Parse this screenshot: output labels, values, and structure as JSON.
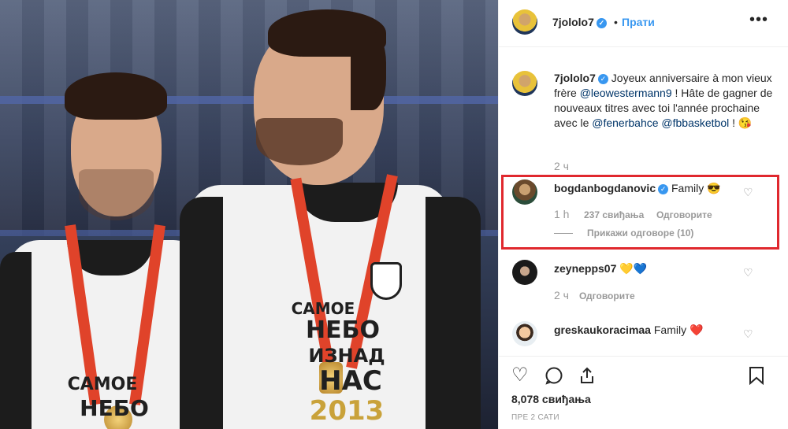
{
  "post": {
    "author": "7jololo7",
    "follow_label": "Прати",
    "more_label": "•••",
    "caption_author": "7jololo7",
    "caption_part1": "Joyeux anniversaire à mon vieux frère ",
    "caption_mention1": "@leowestermann9",
    "caption_part2": " ! Hâte de gagner de nouveaux titres avec toi l'année prochaine avec le ",
    "caption_mention2": "@fenerbahce",
    "caption_part3": " ",
    "caption_mention3": "@fbbasketbol",
    "caption_part4": " ! 😘",
    "caption_time": "2 ч"
  },
  "comments": [
    {
      "user": "bogdanbogdanovic",
      "text": "Family 😎",
      "time": "1 h",
      "likes": "237 свиђања",
      "reply": "Одговорите",
      "view_replies": "Прикажи одговоре (10)"
    },
    {
      "user": "zeynepps07",
      "text": "💛💙",
      "time": "2 ч",
      "reply": "Одговорите"
    },
    {
      "user": "greskaukoracimaa",
      "text": "Family ❤️"
    }
  ],
  "actions": {
    "likes": "8,078 свиђања",
    "ago": "ПРЕ 2 САТИ"
  },
  "photo": {
    "shirt_line1": "САМОЕ",
    "shirt_line2": "НЕБО",
    "shirt_line3": "ИЗНАД",
    "shirt_line4": "НАС",
    "shirt_year": "2013",
    "left_line1": "САМОЕ",
    "left_line2": "НЕБО"
  },
  "colors": {
    "accent_blue": "#3897f0",
    "highlight_red": "#e0282e",
    "ribbon": "#e0432a"
  },
  "icons": {
    "like": "heart-icon",
    "comment": "comment-icon",
    "share": "share-icon",
    "save": "bookmark-icon"
  }
}
